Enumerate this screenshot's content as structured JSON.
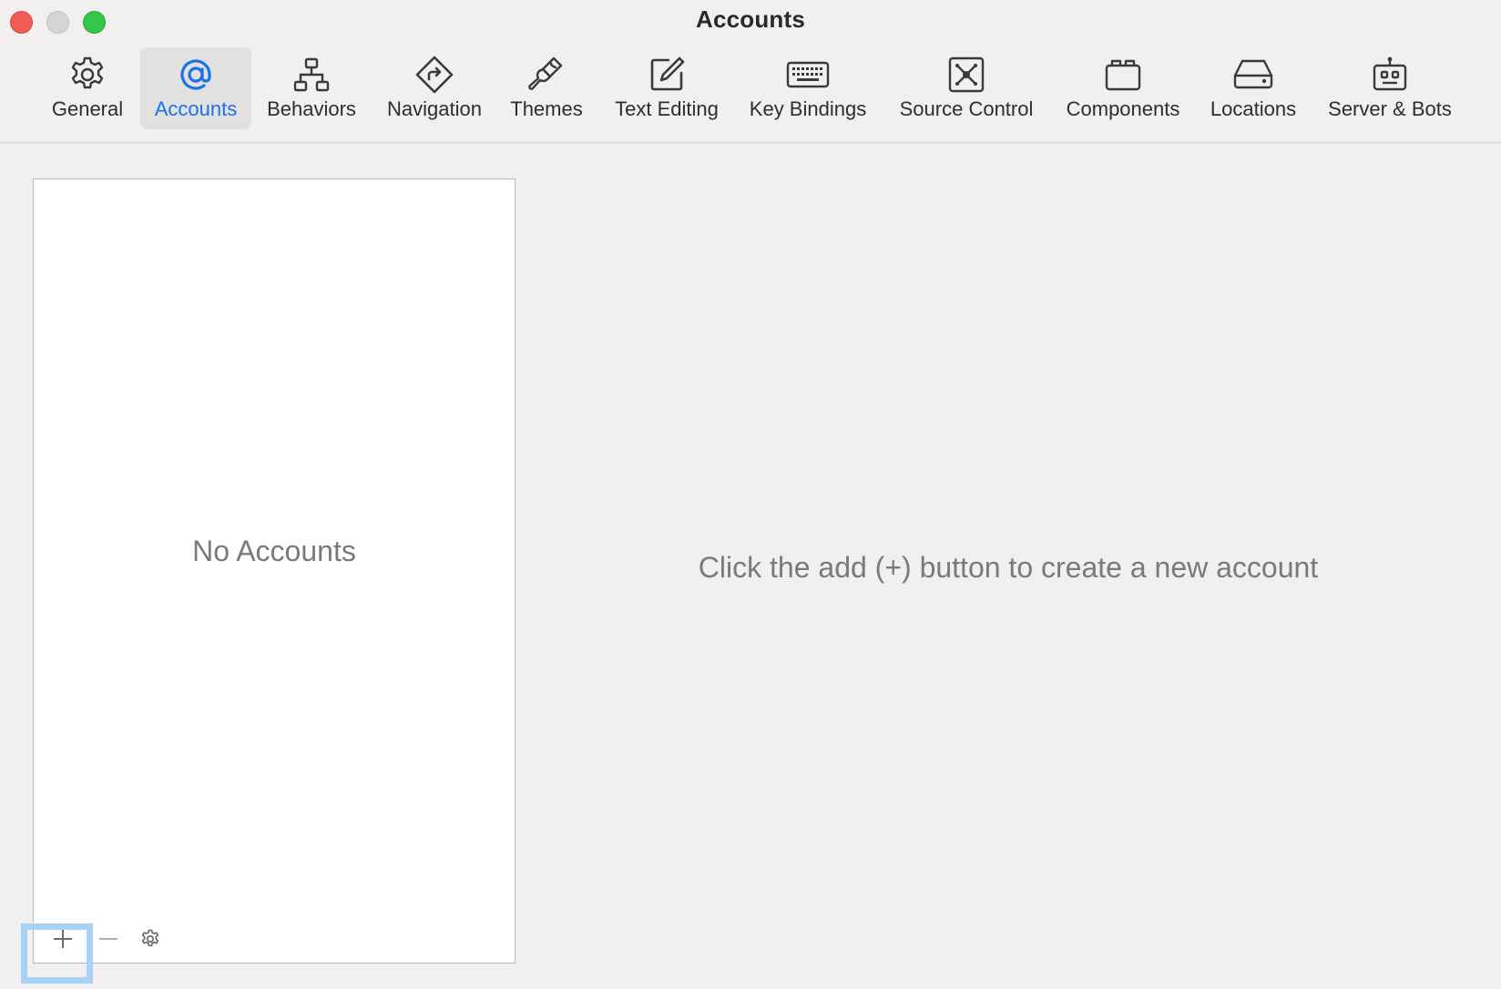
{
  "window": {
    "title": "Accounts"
  },
  "toolbar": {
    "items": [
      {
        "label": "General",
        "icon": "gear-icon",
        "selected": false
      },
      {
        "label": "Accounts",
        "icon": "at-sign-icon",
        "selected": true
      },
      {
        "label": "Behaviors",
        "icon": "hierarchy-icon",
        "selected": false
      },
      {
        "label": "Navigation",
        "icon": "direction-sign-icon",
        "selected": false
      },
      {
        "label": "Themes",
        "icon": "paintbrush-icon",
        "selected": false
      },
      {
        "label": "Text Editing",
        "icon": "edit-square-icon",
        "selected": false
      },
      {
        "label": "Key Bindings",
        "icon": "keyboard-icon",
        "selected": false
      },
      {
        "label": "Source Control",
        "icon": "source-control-icon",
        "selected": false
      },
      {
        "label": "Components",
        "icon": "components-box-icon",
        "selected": false
      },
      {
        "label": "Locations",
        "icon": "drive-icon",
        "selected": false
      },
      {
        "label": "Server & Bots",
        "icon": "robot-icon",
        "selected": false
      }
    ]
  },
  "accounts_list": {
    "empty_text": "No Accounts",
    "add_icon": "plus-icon",
    "remove_icon": "minus-icon",
    "options_icon": "gear-icon"
  },
  "detail": {
    "hint": "Click the add (+) button to create a new account"
  },
  "colors": {
    "accent": "#1a73e8",
    "highlight": "#a8d2f5",
    "close": "#ee5c56",
    "minimize": "#d6d4d5",
    "zoom": "#34c749"
  }
}
